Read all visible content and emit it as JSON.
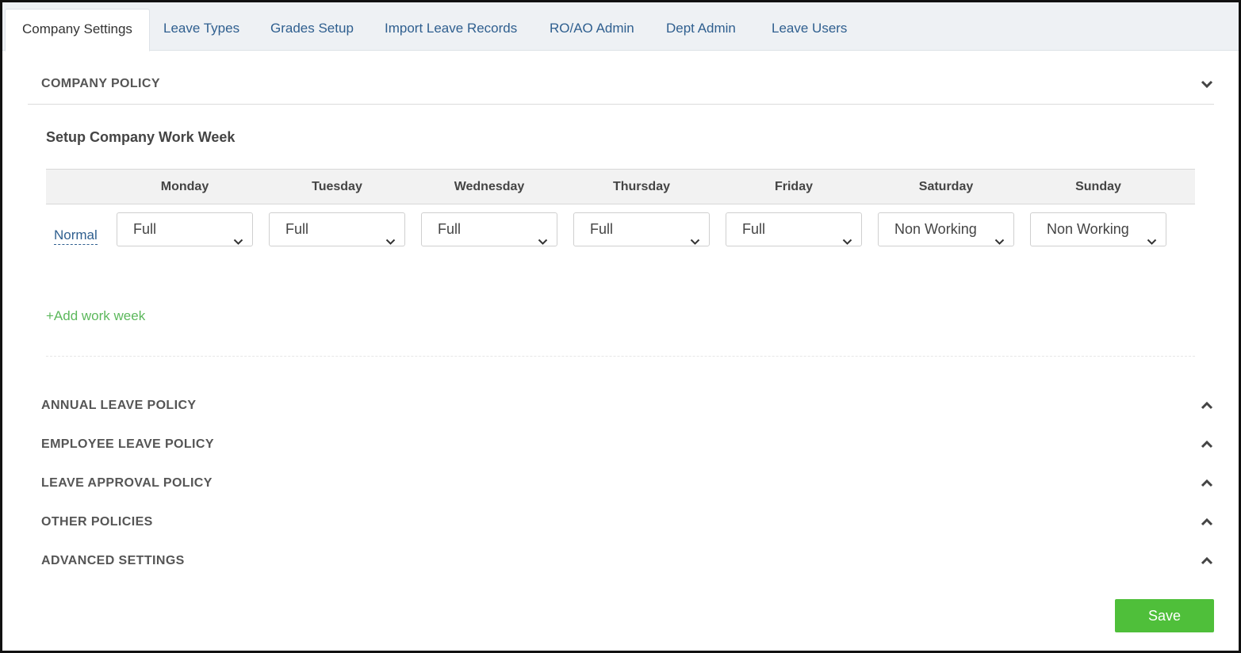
{
  "tabs": [
    {
      "label": "Company Settings",
      "active": true
    },
    {
      "label": "Leave Types"
    },
    {
      "label": "Grades Setup"
    },
    {
      "label": "Import Leave Records"
    },
    {
      "label": "RO/AO Admin"
    },
    {
      "label": "Dept Admin"
    },
    {
      "label": "Leave Users"
    }
  ],
  "company_policy": {
    "title": "COMPANY POLICY",
    "expanded": true,
    "subtitle": "Setup Company Work Week",
    "days": [
      "Monday",
      "Tuesday",
      "Wednesday",
      "Thursday",
      "Friday",
      "Saturday",
      "Sunday"
    ],
    "work_week": {
      "name": "Normal",
      "values": [
        "Full",
        "Full",
        "Full",
        "Full",
        "Full",
        "Non Working",
        "Non Working"
      ]
    },
    "add_link": "+Add work week"
  },
  "sections": [
    {
      "title": "ANNUAL LEAVE POLICY",
      "expanded": false
    },
    {
      "title": "EMPLOYEE LEAVE POLICY",
      "expanded": false
    },
    {
      "title": "LEAVE APPROVAL POLICY",
      "expanded": false
    },
    {
      "title": "OTHER POLICIES",
      "expanded": false
    },
    {
      "title": "ADVANCED SETTINGS",
      "expanded": false
    }
  ],
  "save_label": "Save",
  "colors": {
    "link": "#2f5f8f",
    "add_link": "#5cb85c",
    "save_button": "#4fbf3a"
  }
}
